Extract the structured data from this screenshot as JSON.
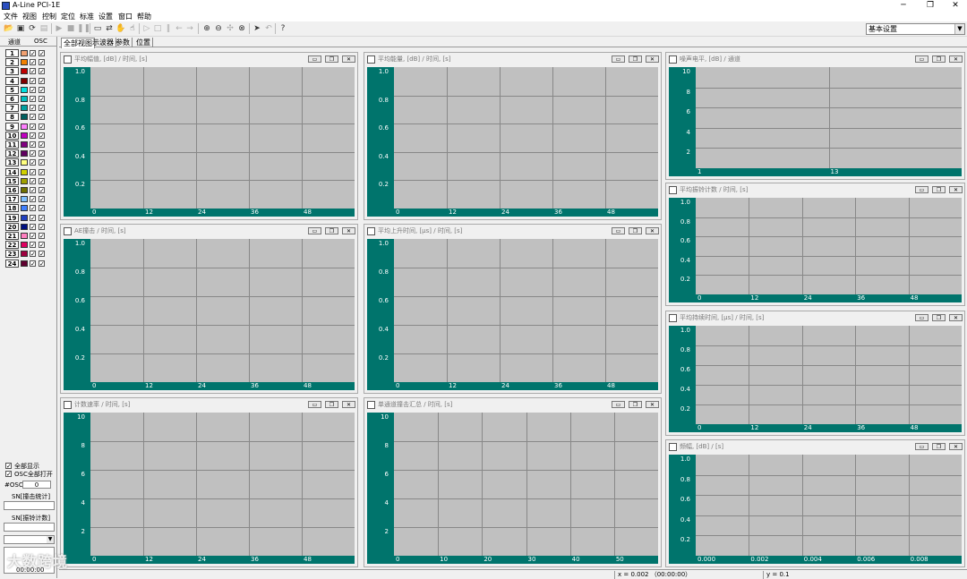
{
  "window": {
    "title": "A-Line PCI-1E"
  },
  "menu": [
    "文件",
    "视图",
    "控制",
    "定位",
    "标准",
    "设置",
    "窗口",
    "帮助"
  ],
  "toolbar": {
    "preset": "基本设置"
  },
  "left": {
    "header": {
      "channel": "通道",
      "osc": "OSC"
    },
    "channels": [
      "1",
      "2",
      "3",
      "4",
      "5",
      "6",
      "7",
      "8",
      "9",
      "10",
      "11",
      "12",
      "13",
      "14",
      "15",
      "16",
      "17",
      "18",
      "19",
      "20",
      "21",
      "22",
      "23",
      "24"
    ],
    "channel_colors": [
      "#f0a070",
      "#f08000",
      "#c00000",
      "#800000",
      "#00e0e0",
      "#00c0c0",
      "#00a0a0",
      "#006060",
      "#ff80ff",
      "#c000c0",
      "#800080",
      "#600060",
      "#ffff80",
      "#d0d000",
      "#a0a000",
      "#707000",
      "#80c0ff",
      "#4080ff",
      "#2040c0",
      "#001080",
      "#ff80c0",
      "#e00060",
      "#a00040",
      "#600030"
    ],
    "show_all": "全部显示",
    "osc_all_open": "OSC全部打开",
    "osc_label": "#OSC",
    "osc_value": "0",
    "sn_hit_stats": "SN[撞击统计]",
    "sn_count": "SN[振铃计数]",
    "time": "00:00:00"
  },
  "tabs": [
    "全部视图",
    "示波器",
    "参数",
    "位置"
  ],
  "panels": [
    {
      "title": "平均幅值, [dB] / 时间, [s]",
      "y": [
        "1.0",
        "0.8",
        "0.6",
        "0.4",
        "0.2"
      ],
      "x": [
        "0",
        "12",
        "24",
        "36",
        "48"
      ]
    },
    {
      "title": "平均能量, [dB] / 时间, [s]",
      "y": [
        "1.0",
        "0.8",
        "0.6",
        "0.4",
        "0.2"
      ],
      "x": [
        "0",
        "12",
        "24",
        "36",
        "48"
      ]
    },
    {
      "title": "噪声电平, [dB] / 通道",
      "y": [
        "10",
        "8",
        "6",
        "4",
        "2"
      ],
      "x": [
        "1",
        "13"
      ]
    },
    {
      "title": "AE撞击 / 时间, [s]",
      "y": [
        "1.0",
        "0.8",
        "0.6",
        "0.4",
        "0.2"
      ],
      "x": [
        "0",
        "12",
        "24",
        "36",
        "48"
      ]
    },
    {
      "title": "平均上升时间, [µs] / 时间, [s]",
      "y": [
        "1.0",
        "0.8",
        "0.6",
        "0.4",
        "0.2"
      ],
      "x": [
        "0",
        "12",
        "24",
        "36",
        "48"
      ]
    },
    {
      "title": "平均振铃计数 / 时间, [s]",
      "y": [
        "1.0",
        "0.8",
        "0.6",
        "0.4",
        "0.2"
      ],
      "x": [
        "0",
        "12",
        "24",
        "36",
        "48"
      ]
    },
    {
      "title": "计数速率 / 时间, [s]",
      "y": [
        "10",
        "8",
        "6",
        "4",
        "2"
      ],
      "x": [
        "0",
        "12",
        "24",
        "36",
        "48"
      ]
    },
    {
      "title": "单通道撞击汇总 / 时间, [s]",
      "y": [
        "10",
        "8",
        "6",
        "4",
        "2"
      ],
      "x": [
        "0",
        "10",
        "20",
        "30",
        "40",
        "50"
      ]
    },
    {
      "title": "平均持续时间, [µs] / 时间, [s]",
      "y": [
        "1.0",
        "0.8",
        "0.6",
        "0.4",
        "0.2"
      ],
      "x": [
        "0",
        "12",
        "24",
        "36",
        "48"
      ]
    },
    {
      "title": "频幅, [dB] / [s]",
      "y": [
        "1.0",
        "0.8",
        "0.6",
        "0.4",
        "0.2"
      ],
      "x": [
        "0.000",
        "0.002",
        "0.004",
        "0.006",
        "0.008"
      ]
    }
  ],
  "status": {
    "x": "x = 0.002  （00:00:00）",
    "y": "y = 0.1"
  },
  "watermark": "大数跨境"
}
